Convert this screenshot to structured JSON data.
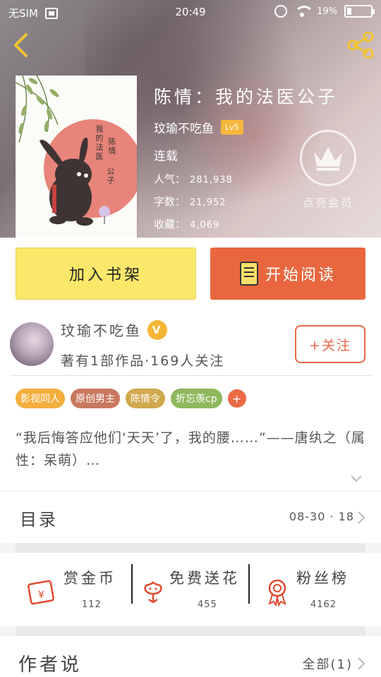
{
  "status_bar": {
    "carrier": "无SIM",
    "time": "20:49",
    "battery_percent": "19",
    "battery_level": 0.19
  },
  "book": {
    "title": "陈情：我的法医公子",
    "author": "玟瑜不吃鱼",
    "level": "Lv5",
    "status": "连载",
    "stats": [
      {
        "label": "人气：",
        "value": "281,938"
      },
      {
        "label": "字数：",
        "value": "21,952"
      },
      {
        "label": "收藏：",
        "value": "4,069"
      }
    ],
    "cover_text": {
      "col1": "我的法医",
      "col2": "陈情",
      "col3": "公子"
    },
    "member_label": "点亮会员"
  },
  "actions": {
    "add_shelf": "加入书架",
    "start_read": "开始阅读"
  },
  "author_panel": {
    "name": "玟瑜不吃鱼",
    "verified_mark": "V",
    "meta": "著有1部作品·169人关注",
    "follow": "+关注"
  },
  "tags": [
    {
      "label": "影视同人",
      "color": "#f4ae3d"
    },
    {
      "label": "原创男主",
      "color": "#c9785f"
    },
    {
      "label": "陈情令",
      "color": "#d0a84d"
    },
    {
      "label": "折忘羡cp",
      "color": "#8fb85c"
    }
  ],
  "tag_more": "+",
  "intro": {
    "text": "“我后悔答应他们‘天天’了，我的腰……”——唐纨之（属性：呆萌）…"
  },
  "toc": {
    "title": "目录",
    "latest": "08-30 · 18"
  },
  "rewards": [
    {
      "label": "赏金币",
      "count": "112"
    },
    {
      "label": "免费送花",
      "count": "455"
    },
    {
      "label": "粉丝榜",
      "count": "4162"
    }
  ],
  "author_says": {
    "title": "作者说",
    "all": "全部(1)"
  },
  "colors": {
    "accent_orange": "#e9673e",
    "button_yellow": "#fbe86a",
    "badge_gold": "#f6b73c"
  }
}
